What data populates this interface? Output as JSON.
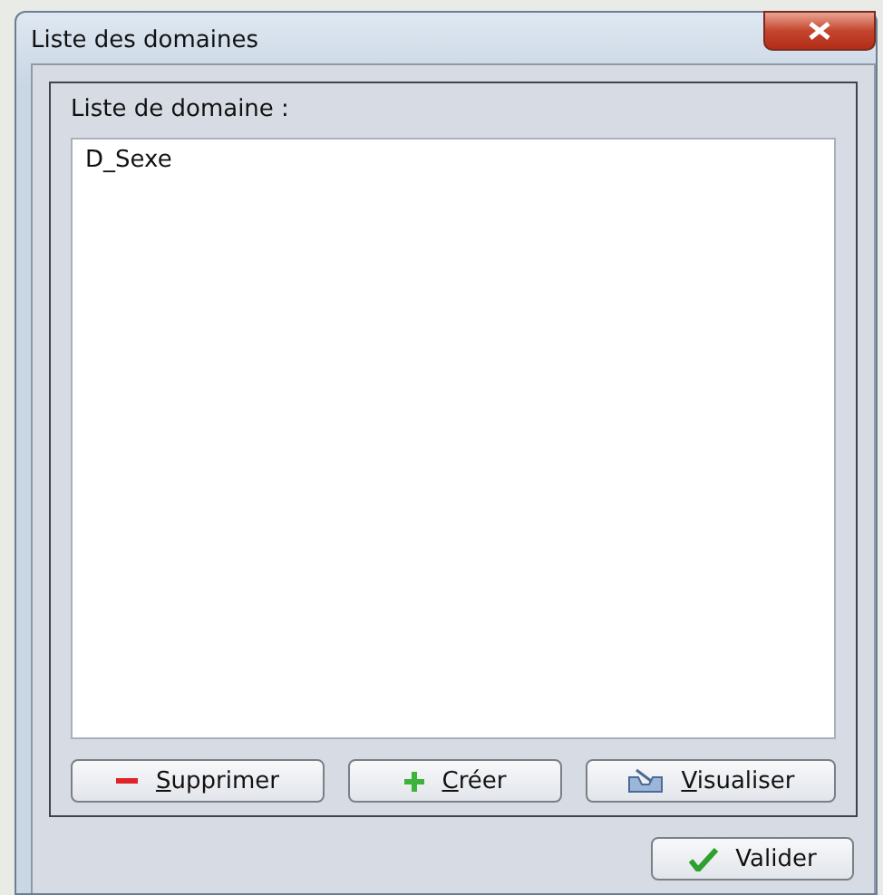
{
  "window": {
    "title": "Liste des domaines"
  },
  "panel": {
    "label": "Liste de domaine :",
    "items": [
      {
        "text": "D_Sexe",
        "selected": false
      }
    ]
  },
  "actions": [
    {
      "kind": "remove",
      "label": "Supprimer",
      "underline_first": true
    },
    {
      "kind": "create",
      "label": "Créer",
      "underline_first": true
    },
    {
      "kind": "view",
      "label": "Visualiser",
      "underline_first": true
    }
  ],
  "confirm": {
    "kind": "check",
    "label": "Valider",
    "underline_first": false
  }
}
